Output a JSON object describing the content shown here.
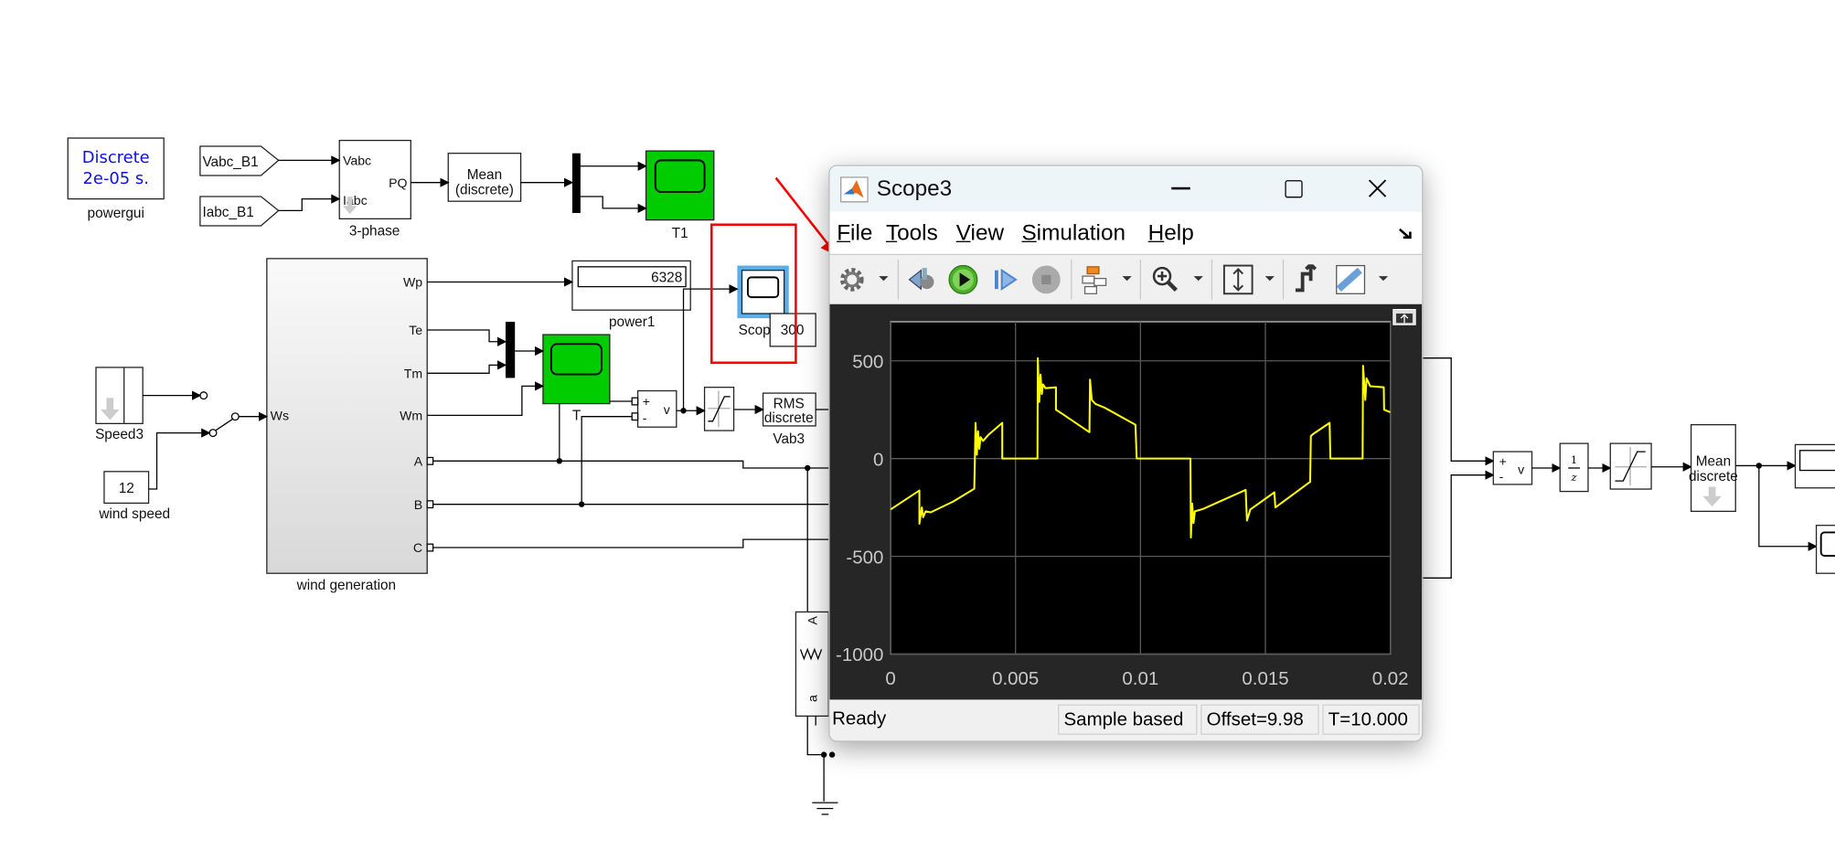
{
  "diagram": {
    "powergui": {
      "line1": "Discrete",
      "line2": "2e-05 s.",
      "label": "powergui"
    },
    "goto_vabc": "Vabc_B1",
    "goto_iabc": "Iabc_B1",
    "three_phase": {
      "in1": "Vabc",
      "in2": "Iabc",
      "out": "PQ",
      "label": "3-phase"
    },
    "mean1": {
      "line1": "Mean",
      "line2": "(discrete)"
    },
    "t1_label": "T1",
    "wind_gen": {
      "label": "wind generation",
      "ports_out": [
        "Wp",
        "Te",
        "Tm",
        "Wm",
        "A",
        "B",
        "C"
      ],
      "port_in": "Ws"
    },
    "power1": {
      "value": "6328",
      "label": "power1"
    },
    "scope3_label": "Scop",
    "const300": "300",
    "t_label": "T",
    "sum1": {
      "plus": "+",
      "minus": "-",
      "out": "v"
    },
    "rms": {
      "line1": "RMS",
      "line2": "discrete",
      "label": "Vab3"
    },
    "speed3_label": "Speed3",
    "wind_speed": {
      "value": "12",
      "label": "wind speed"
    },
    "transformer": {
      "top": "A",
      "bottom": "a"
    },
    "sum2": {
      "plus": "+",
      "minus": "-",
      "out": "v"
    },
    "unit_delay": {
      "num": "1",
      "den": "z"
    },
    "mean2": {
      "line1": "Mean",
      "line2": "discrete"
    },
    "highlight_color": "#ff0000",
    "scope_green": "#00cc00"
  },
  "scope_window": {
    "title": "Scope3",
    "menu": [
      "File",
      "Tools",
      "View",
      "Simulation",
      "Help"
    ],
    "toolbar": [
      "settings-gear",
      "step-back",
      "run",
      "step-forward",
      "stop",
      "signal-selector",
      "zoom-in",
      "autoscale",
      "triggers",
      "measurements-ruler"
    ],
    "status": {
      "state": "Ready",
      "mode": "Sample based",
      "offset": "Offset=9.98",
      "time": "T=10.000"
    }
  },
  "chart_data": {
    "type": "line",
    "title": "",
    "xlabel": "",
    "ylabel": "",
    "xlim": [
      0,
      0.02
    ],
    "ylim": [
      -1000,
      700
    ],
    "xticks": [
      "0",
      "0.005",
      "0.01",
      "0.015",
      "0.02"
    ],
    "xtick_values": [
      0,
      0.005,
      0.01,
      0.015,
      0.02
    ],
    "yticks": [
      "500",
      "0",
      "-500",
      "-1000"
    ],
    "ytick_values": [
      500,
      0,
      -500,
      -1000
    ],
    "grid": true,
    "background": "#000000",
    "line_color": "#ffff00",
    "series": [
      {
        "x": [
          0,
          0.00115,
          0.00115,
          0.00125,
          0.0013,
          0.0014,
          0.0016,
          0.0025,
          0.00335,
          0.0034,
          0.00345,
          0.0035,
          0.00355,
          0.0036,
          0.0037,
          0.0039,
          0.00447,
          0.00447,
          0.00588,
          0.00589,
          0.00595,
          0.006,
          0.00605,
          0.0061,
          0.0062,
          0.00662,
          0.00662,
          0.0068,
          0.00796,
          0.00798,
          0.00805,
          0.0082,
          0.00857,
          0.0098,
          0.00985,
          0.012,
          0.01202,
          0.01207,
          0.01212,
          0.01218,
          0.0125,
          0.01421,
          0.01426,
          0.0144,
          0.01536,
          0.0154,
          0.0156,
          0.01679,
          0.01682,
          0.0169,
          0.01757,
          0.0176,
          0.01889,
          0.01891,
          0.019,
          0.01905,
          0.0192,
          0.01974,
          0.01975,
          0.02
        ],
        "y": [
          -260,
          -163,
          -333,
          -250,
          -300,
          -270,
          -275,
          -220,
          -154,
          183,
          20,
          140,
          50,
          110,
          90,
          120,
          183,
          0,
          0,
          513,
          290,
          430,
          330,
          380,
          360,
          365,
          250,
          235,
          135,
          404,
          300,
          279,
          260,
          173,
          0,
          0,
          -404,
          -230,
          -330,
          -270,
          -258,
          -160,
          -317,
          -260,
          -173,
          -250,
          -231,
          -119,
          115,
          125,
          183,
          0,
          0,
          475,
          300,
          410,
          370,
          365,
          250,
          237
        ]
      }
    ]
  }
}
